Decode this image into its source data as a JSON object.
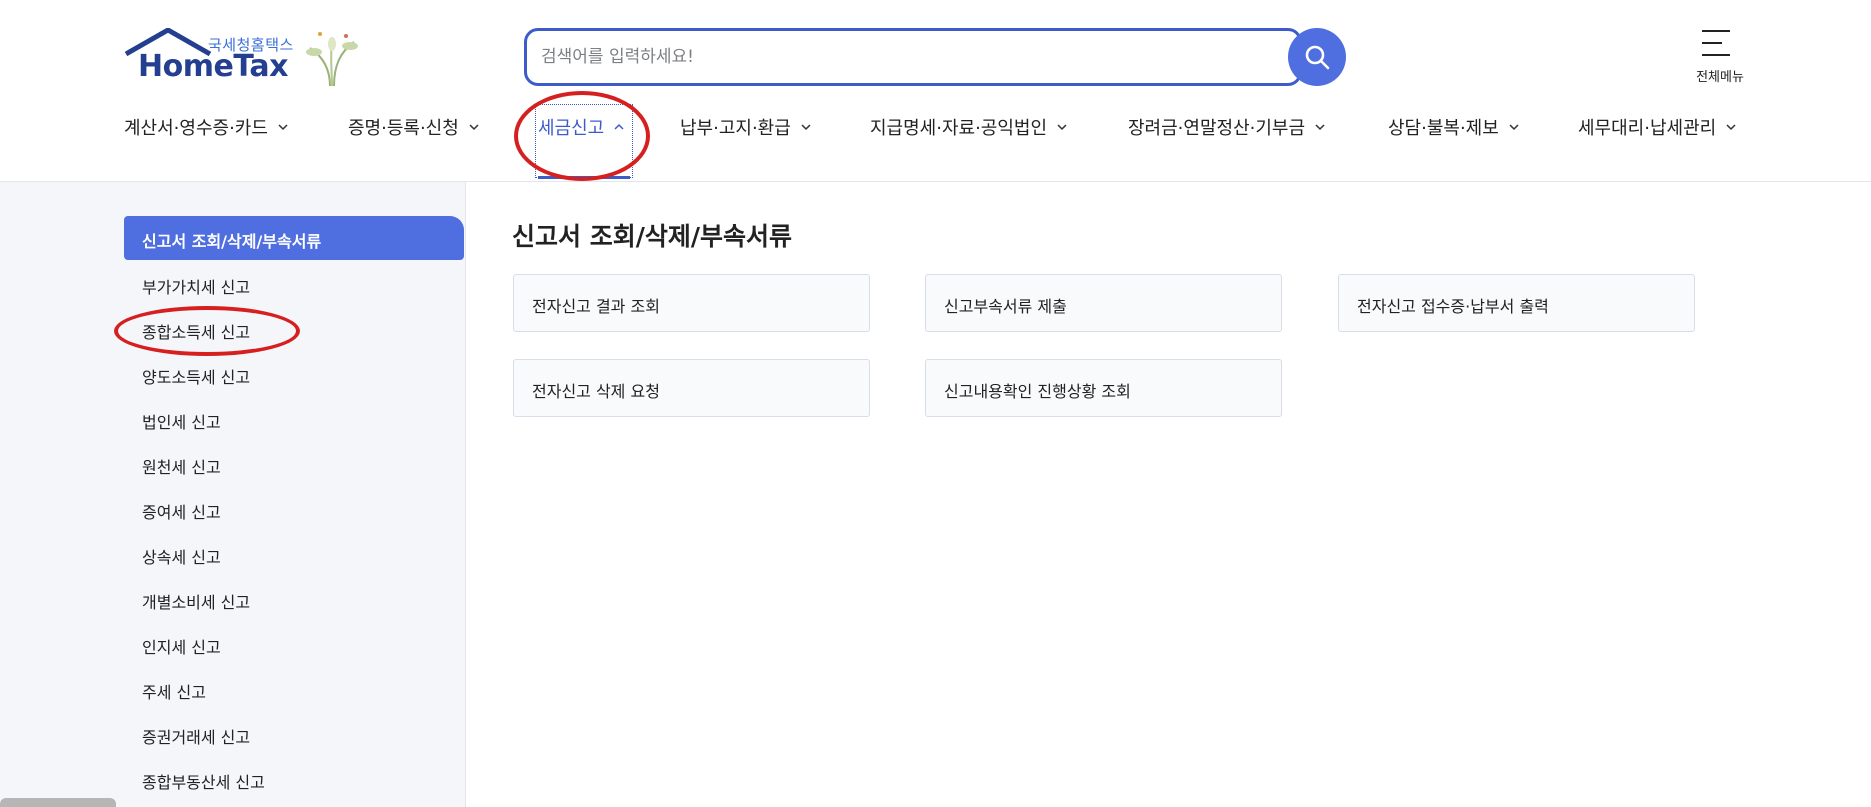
{
  "logo": {
    "sub": "국세청홈택스",
    "main": "HomeTax"
  },
  "search": {
    "placeholder": "검색어를 입력하세요!"
  },
  "allmenu": {
    "label": "전체메뉴"
  },
  "gnb": [
    {
      "label": "계산서·영수증·카드"
    },
    {
      "label": "증명·등록·신청"
    },
    {
      "label": "세금신고"
    },
    {
      "label": "납부·고지·환급"
    },
    {
      "label": "지급명세·자료·공익법인"
    },
    {
      "label": "장려금·연말정산·기부금"
    },
    {
      "label": "상담·불복·제보"
    },
    {
      "label": "세무대리·납세관리"
    }
  ],
  "sidebar": {
    "active": "신고서 조회/삭제/부속서류",
    "items": [
      "부가가치세 신고",
      "종합소득세 신고",
      "양도소득세 신고",
      "법인세 신고",
      "원천세 신고",
      "증여세 신고",
      "상속세 신고",
      "개별소비세 신고",
      "인지세 신고",
      "주세 신고",
      "증권거래세 신고",
      "종합부동산세 신고"
    ]
  },
  "main": {
    "title": "신고서 조회/삭제/부속서류",
    "cards": [
      "전자신고 결과 조회",
      "신고부속서류 제출",
      "전자신고 접수증·납부서 출력",
      "전자신고 삭제 요청",
      "신고내용확인 진행상황 조회"
    ]
  },
  "colors": {
    "accent": "#4f6ee0",
    "highlight": "#d62020",
    "nav_active": "#3d5cc9"
  }
}
